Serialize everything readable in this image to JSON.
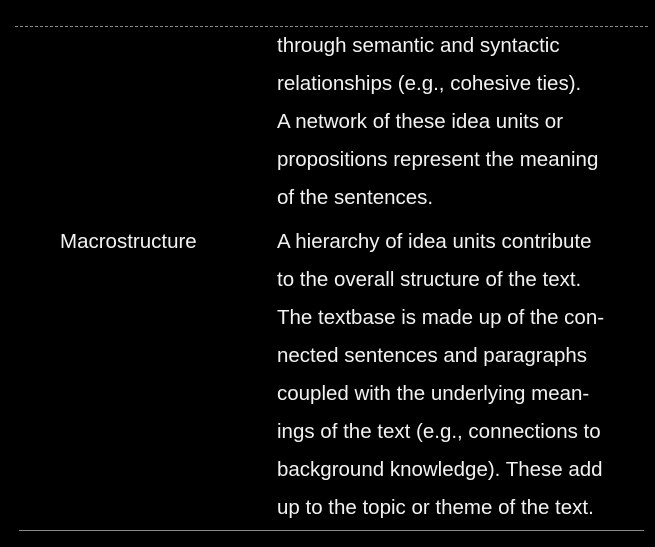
{
  "table": {
    "rows": [
      {
        "label": "",
        "lines": [
          "through semantic and syntactic",
          "relationships (e.g., cohesive ties).",
          "A network of these idea units or",
          "propositions represent the meaning",
          "of the sentences."
        ]
      },
      {
        "label": "Macrostructure",
        "lines": [
          "A hierarchy of idea units contribute",
          "to the overall structure of the text.",
          "The textbase is made up of the con-",
          "nected sentences and paragraphs",
          "coupled with the underlying mean-",
          "ings of the text (e.g., connections to",
          "background knowledge). These add",
          "up to the topic or theme of the text."
        ]
      }
    ]
  },
  "colors": {
    "background": "#000000",
    "text": "#f2f2f2",
    "rule": "#8a8a8a"
  }
}
